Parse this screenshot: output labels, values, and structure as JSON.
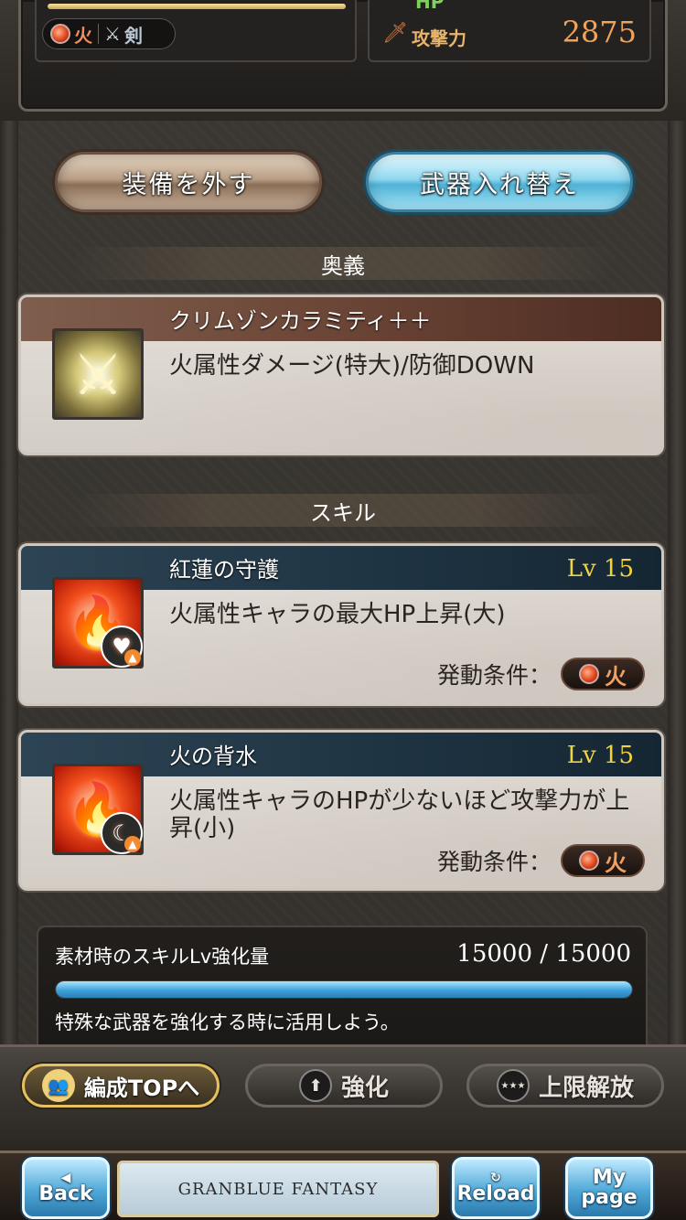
{
  "status": {
    "element": "火",
    "weapon_type": "剣",
    "hp_label": "HP",
    "hp_value": "",
    "attack_label": "攻撃力",
    "attack_value": "2875"
  },
  "buttons": {
    "unequip": "装備を外す",
    "swap": "武器入れ替え"
  },
  "ougi": {
    "section_title": "奥義",
    "name": "クリムゾンカラミティ＋＋",
    "description": "火属性ダメージ(特大)/防御DOWN",
    "icon": "crossed-swords-icon"
  },
  "skills": {
    "section_title": "スキル",
    "items": [
      {
        "name": "紅蓮の守護",
        "level": "Lv 15",
        "description": "火属性キャラの最大HP上昇(大)",
        "condition_label": "発動条件：",
        "condition_element": "火",
        "icon": "fire-heart-icon"
      },
      {
        "name": "火の背水",
        "level": "Lv 15",
        "description": "火属性キャラのHPが少ないほど攻撃力が上昇(小)",
        "condition_label": "発動条件：",
        "condition_element": "火",
        "icon": "fire-crescent-icon"
      }
    ]
  },
  "material": {
    "title": "素材時のスキルLv強化量",
    "value": "15000 / 15000",
    "progress": 1.0,
    "note": "特殊な武器を強化する時に活用しよう。"
  },
  "actions": {
    "party_top": "編成TOPへ",
    "enhance": "強化",
    "limit_break": "上限解放"
  },
  "nav": {
    "back": "Back",
    "logo": "GRANBLUE FANTASY",
    "reload": "Reload",
    "mypage_1": "My",
    "mypage_2": "page"
  },
  "colors": {
    "fire": "#e0471c",
    "accent_blue": "#4fb2d6",
    "level_gold": "#f1d33a",
    "attack_orange": "#f0a35a"
  }
}
